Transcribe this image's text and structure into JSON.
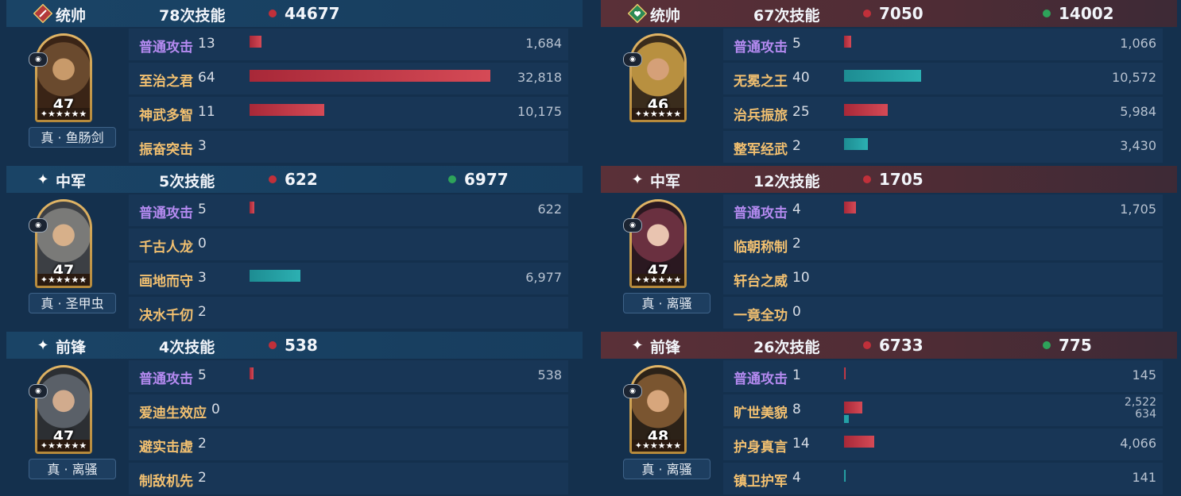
{
  "left": {
    "units": [
      {
        "role": "统帅",
        "role_icon": "commander-sword-icon",
        "casts": "78次技能",
        "damage": "44677",
        "heal": null,
        "level": "47",
        "stars": "✦★★★★★",
        "equipment": "真 · 鱼肠剑",
        "skills": [
          {
            "name": "普通攻击",
            "count": "13",
            "value": "1,684",
            "dmg_frac": 0.05,
            "normal": true
          },
          {
            "name": "至治之君",
            "count": "64",
            "value": "32,818",
            "dmg_frac": 1.0
          },
          {
            "name": "神武多智",
            "count": "11",
            "value": "10,175",
            "dmg_frac": 0.31
          },
          {
            "name": "振奋突击",
            "count": "3",
            "value": ""
          }
        ]
      },
      {
        "role": "中军",
        "role_icon": "star-icon",
        "casts": "5次技能",
        "damage": "622",
        "heal": "6977",
        "level": "47",
        "stars": "✦★★★★★",
        "equipment": "真 · 圣甲虫",
        "skills": [
          {
            "name": "普通攻击",
            "count": "5",
            "value": "622",
            "dmg_frac": 0.02,
            "normal": true
          },
          {
            "name": "千古人龙",
            "count": "0",
            "value": ""
          },
          {
            "name": "画地而守",
            "count": "3",
            "value": "6,977",
            "heal_frac": 0.21
          },
          {
            "name": "决水千仞",
            "count": "2",
            "value": ""
          }
        ]
      },
      {
        "role": "前锋",
        "role_icon": "star-icon",
        "casts": "4次技能",
        "damage": "538",
        "heal": null,
        "level": "47",
        "stars": "✦★★★★★",
        "equipment": "真 · 离骚",
        "skills": [
          {
            "name": "普通攻击",
            "count": "5",
            "value": "538",
            "dmg_frac": 0.016,
            "normal": true
          },
          {
            "name": "爱迪生效应",
            "count": "0",
            "value": ""
          },
          {
            "name": "避实击虚",
            "count": "2",
            "value": ""
          },
          {
            "name": "制敌机先",
            "count": "2",
            "value": ""
          }
        ]
      }
    ]
  },
  "right": {
    "units": [
      {
        "role": "统帅",
        "role_icon": "commander-heart-icon",
        "casts": "67次技能",
        "damage": "7050",
        "heal": "14002",
        "level": "46",
        "stars": "✦★★★★★",
        "equipment": "",
        "skills": [
          {
            "name": "普通攻击",
            "count": "5",
            "value": "1,066",
            "dmg_frac": 0.03,
            "normal": true
          },
          {
            "name": "无冕之王",
            "count": "40",
            "value": "10,572",
            "heal_frac": 0.32
          },
          {
            "name": "治兵振旅",
            "count": "25",
            "value": "5,984",
            "dmg_frac": 0.18
          },
          {
            "name": "整军经武",
            "count": "2",
            "value": "3,430",
            "heal_frac": 0.1
          }
        ]
      },
      {
        "role": "中军",
        "role_icon": "star-icon",
        "casts": "12次技能",
        "damage": "1705",
        "heal": null,
        "level": "47",
        "stars": "✦★★★★★",
        "equipment": "真 · 离骚",
        "skills": [
          {
            "name": "普通攻击",
            "count": "4",
            "value": "1,705",
            "dmg_frac": 0.05,
            "normal": true
          },
          {
            "name": "临朝称制",
            "count": "2",
            "value": ""
          },
          {
            "name": "轩台之威",
            "count": "10",
            "value": ""
          },
          {
            "name": "一竟全功",
            "count": "0",
            "value": ""
          }
        ]
      },
      {
        "role": "前锋",
        "role_icon": "star-icon",
        "casts": "26次技能",
        "damage": "6733",
        "heal": "775",
        "level": "48",
        "stars": "✦★★★★★",
        "equipment": "真 · 离骚",
        "skills": [
          {
            "name": "普通攻击",
            "count": "1",
            "value": "145",
            "dmg_frac": 0.005,
            "normal": true
          },
          {
            "name": "旷世美貌",
            "count": "8",
            "value": "2,522",
            "value2": "634",
            "dmg_frac": 0.077,
            "heal_frac2": 0.019
          },
          {
            "name": "护身真言",
            "count": "14",
            "value": "4,066",
            "dmg_frac": 0.124
          },
          {
            "name": "镇卫护军",
            "count": "4",
            "value": "141",
            "heal_frac": 0.004
          }
        ]
      }
    ]
  },
  "colors": {
    "damage": "#c0303a",
    "heal": "#2ea35a",
    "skill_name": "#f2c070",
    "normal_attack": "#b48af0"
  }
}
